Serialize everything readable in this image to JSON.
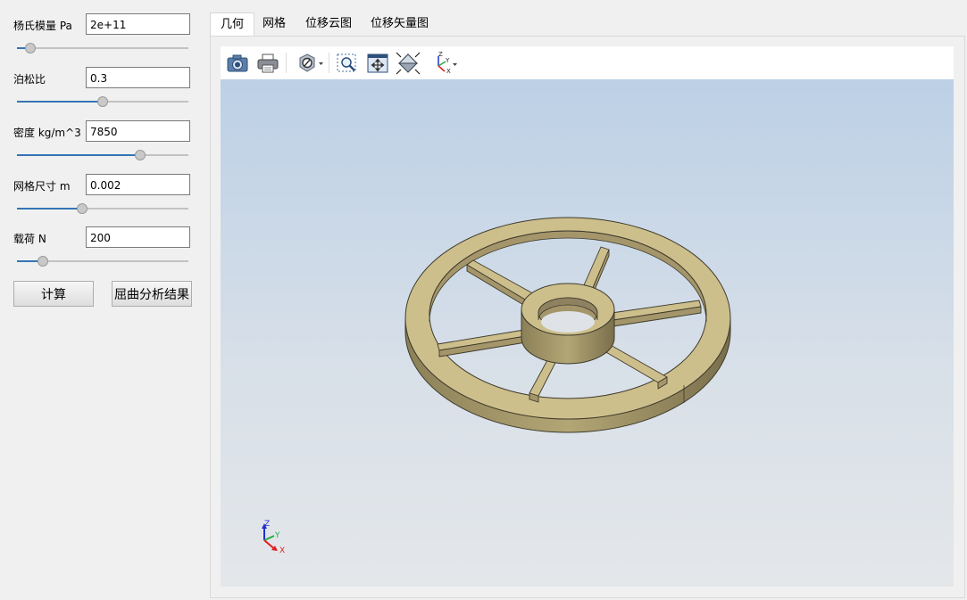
{
  "params": [
    {
      "label": "杨氏模量 Pa",
      "value": "2e+11",
      "slider": 0.08
    },
    {
      "label": "泊松比",
      "value": "0.3",
      "slider": 0.5
    },
    {
      "label": "密度 kg/m^3",
      "value": "7850",
      "slider": 0.72
    },
    {
      "label": "网格尺寸 m",
      "value": "0.002",
      "slider": 0.38
    },
    {
      "label": "载荷 N",
      "value": "200",
      "slider": 0.15
    }
  ],
  "buttons": {
    "compute": "计算",
    "buckling": "屈曲分析结果"
  },
  "tabs": [
    "几何",
    "网格",
    "位移云图",
    "位移矢量图"
  ],
  "active_tab": 0,
  "toolbar": [
    "camera-icon",
    "print-icon",
    "display-mode-icon",
    "zoom-box-icon",
    "fit-all-icon",
    "isometric-view-icon",
    "axis-view-icon"
  ],
  "triad": {
    "z": "Z",
    "y": "Y",
    "x": "X"
  },
  "colors": {
    "accent": "#3375b5",
    "model": "#cdbf8c",
    "model_dark": "#a4966a",
    "axis_x": "#e02020",
    "axis_y": "#20b040",
    "axis_z": "#2030d0"
  }
}
